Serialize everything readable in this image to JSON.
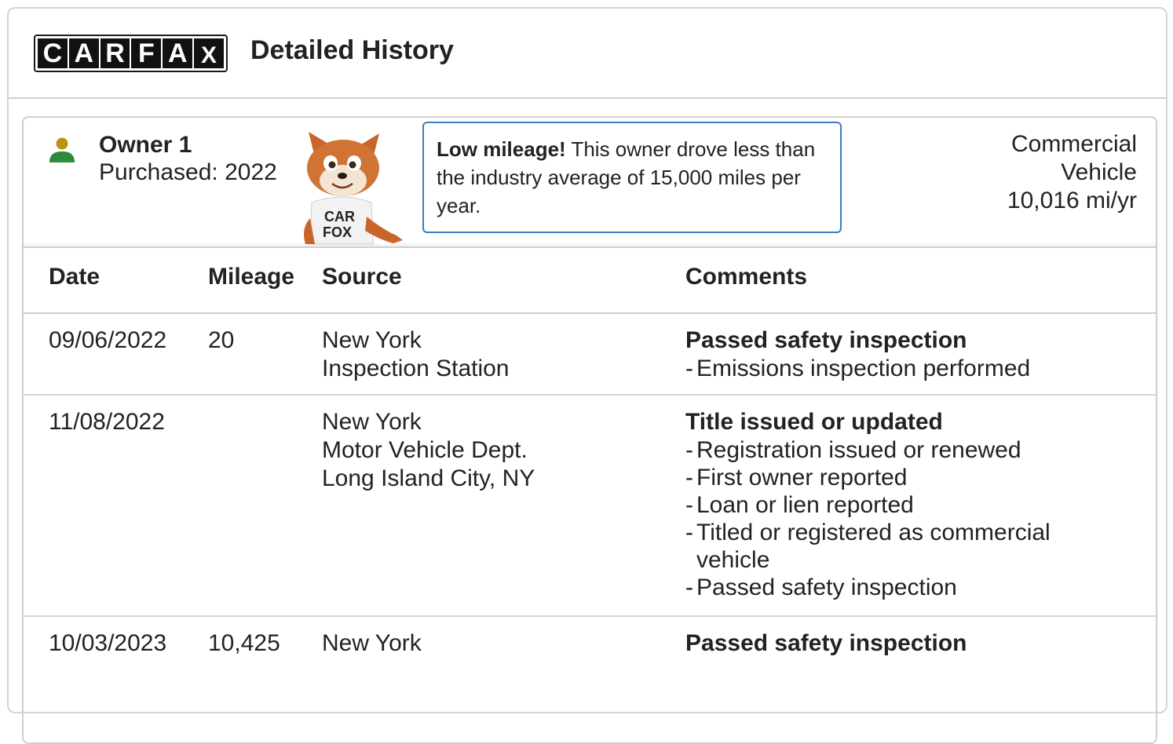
{
  "header": {
    "logo_letters": [
      "C",
      "A",
      "R",
      "F",
      "A",
      "X"
    ],
    "title": "Detailed History"
  },
  "owner": {
    "name": "Owner 1",
    "purchased": "Purchased: 2022",
    "icon": "person-icon",
    "mascot_shirt": "CAR FOX",
    "callout_bold": "Low mileage!",
    "callout_text": " This owner drove less than the industry average of 15,000 miles per year.",
    "vehicle_type_line1": "Commercial",
    "vehicle_type_line2": "Vehicle",
    "mileage_per_year": "10,016 mi/yr"
  },
  "table": {
    "headers": {
      "date": "Date",
      "mileage": "Mileage",
      "source": "Source",
      "comments": "Comments"
    },
    "rows": [
      {
        "date": "09/06/2022",
        "mileage": "20",
        "source": [
          "New York",
          "Inspection Station"
        ],
        "comment_title": "Passed safety inspection",
        "comment_items": [
          "Emissions inspection performed"
        ]
      },
      {
        "date": "11/08/2022",
        "mileage": "",
        "source": [
          "New York",
          "Motor Vehicle Dept.",
          "Long Island City, NY"
        ],
        "comment_title": "Title issued or updated",
        "comment_items": [
          "Registration issued or renewed",
          "First owner reported",
          "Loan or lien reported",
          "Titled or registered as commercial vehicle",
          "Passed safety inspection"
        ]
      },
      {
        "date": "10/03/2023",
        "mileage": "10,425",
        "source": [
          "New York"
        ],
        "comment_title": "Passed safety inspection",
        "comment_items": []
      }
    ]
  },
  "colors": {
    "accent_blue": "#3a7cc0",
    "owner_head": "#b8960c",
    "owner_body": "#2e8b3a"
  }
}
